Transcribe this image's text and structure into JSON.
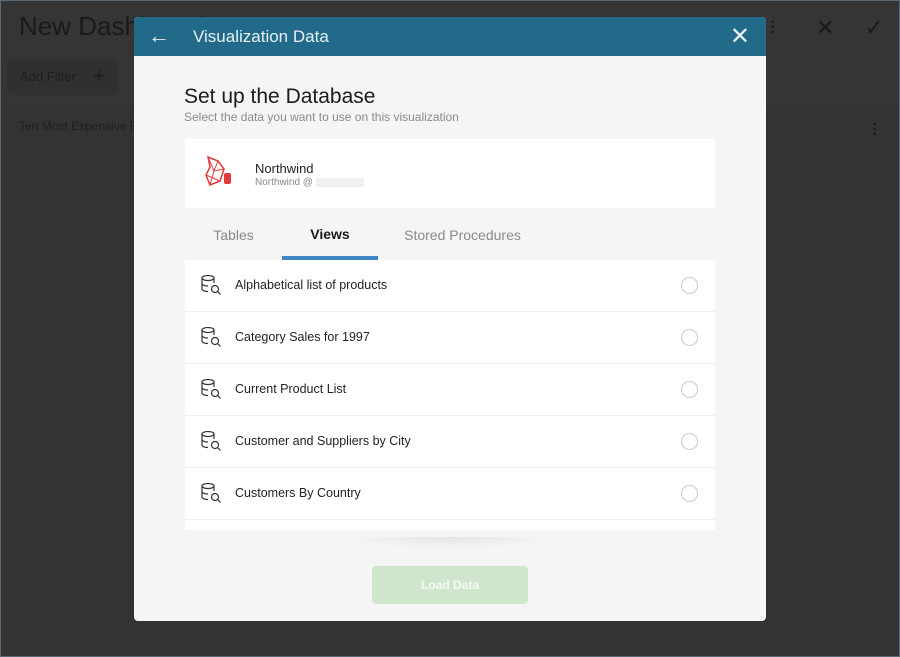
{
  "app": {
    "title": "New Dashboard",
    "add_filter": "Add Filter",
    "plus": "+",
    "section_title": "Ten Most Expensive Products"
  },
  "modal": {
    "title": "Visualization Data",
    "heading": "Set up the Database",
    "subheading": "Select the data you want to use on this visualization",
    "datasource": {
      "name": "Northwind",
      "host": "Northwind @"
    },
    "tabs": [
      {
        "label": "Tables"
      },
      {
        "label": "Views"
      },
      {
        "label": "Stored Procedures"
      }
    ],
    "active_tab": "Views",
    "items": [
      {
        "label": "Alphabetical list of products"
      },
      {
        "label": "Category Sales for 1997"
      },
      {
        "label": "Current Product List"
      },
      {
        "label": "Customer and Suppliers by City"
      },
      {
        "label": "Customers By Country"
      }
    ],
    "load_button": "Load Data"
  },
  "colors": {
    "header": "#216a89",
    "accent": "#3e86c4",
    "button": "#cfe6cd"
  }
}
